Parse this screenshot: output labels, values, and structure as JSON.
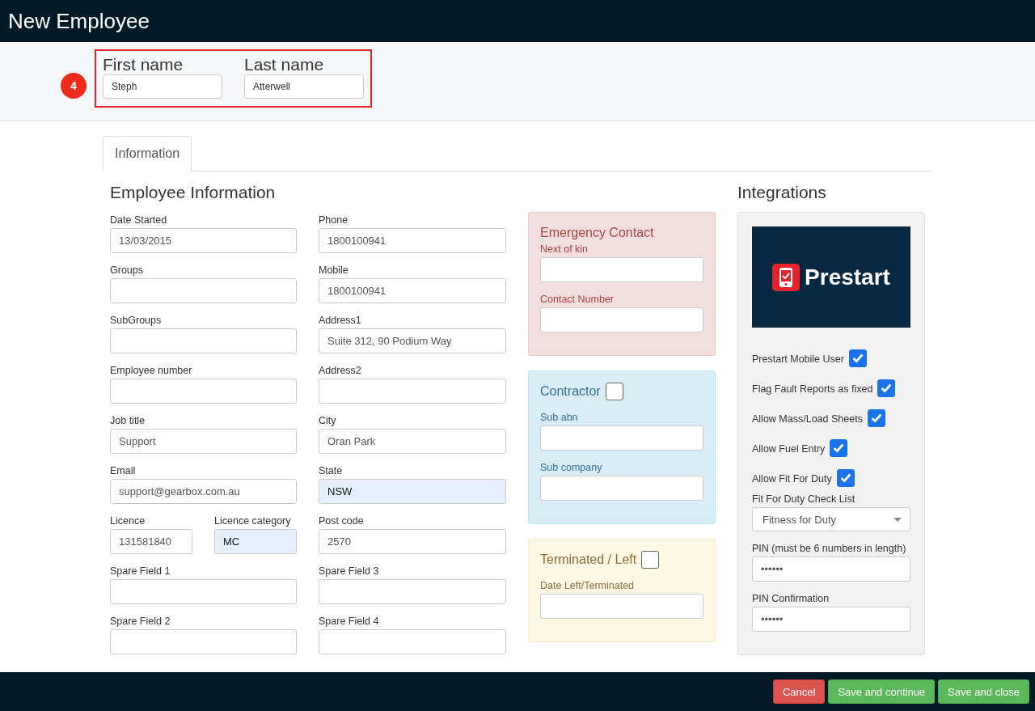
{
  "header": {
    "title": "New Employee"
  },
  "step_badge": "4",
  "name_fields": [
    {
      "label": "First name",
      "value": "Steph"
    },
    {
      "label": "Last name",
      "value": "Atterwell"
    }
  ],
  "tabs": [
    {
      "label": "Information",
      "selected": true
    }
  ],
  "employee_information": {
    "title": "Employee Information",
    "columns": [
      [
        {
          "fields": [
            {
              "label": "Date Started",
              "value": "13/03/2015",
              "autofilled": false
            }
          ]
        },
        {
          "fields": [
            {
              "label": "Groups",
              "autofilled": false
            }
          ]
        },
        {
          "fields": [
            {
              "label": "SubGroups",
              "autofilled": false
            }
          ]
        },
        {
          "fields": [
            {
              "label": "Employee number",
              "autofilled": false
            }
          ]
        },
        {
          "fields": [
            {
              "label": "Job title",
              "value": "Support",
              "autofilled": false
            }
          ]
        },
        {
          "fields": [
            {
              "label": "Email",
              "value": "support@gearbox.com.au",
              "autofilled": false
            }
          ]
        },
        {
          "fields": [
            {
              "label": "Licence",
              "value": "131581840",
              "autofilled": false
            },
            {
              "label": "Licence category",
              "value": "MC",
              "autofilled": true
            }
          ]
        },
        {
          "fields": [
            {
              "label": "Spare Field 1",
              "autofilled": false
            }
          ]
        },
        {
          "fields": [
            {
              "label": "Spare Field 2",
              "autofilled": false
            }
          ]
        }
      ],
      [
        {
          "fields": [
            {
              "label": "Phone",
              "value": "1800100941",
              "autofilled": false
            }
          ]
        },
        {
          "fields": [
            {
              "label": "Mobile",
              "value": "1800100941",
              "autofilled": false
            }
          ]
        },
        {
          "fields": [
            {
              "label": "Address1",
              "value": "Suite 312, 90 Podium Way",
              "autofilled": false
            }
          ]
        },
        {
          "fields": [
            {
              "label": "Address2",
              "autofilled": false
            }
          ]
        },
        {
          "fields": [
            {
              "label": "City",
              "value": "Oran Park",
              "autofilled": false
            }
          ]
        },
        {
          "fields": [
            {
              "label": "State",
              "value": "NSW",
              "autofilled": true
            }
          ]
        },
        {
          "fields": [
            {
              "label": "Post code",
              "value": "2570",
              "autofilled": false
            }
          ]
        },
        {
          "fields": [
            {
              "label": "Spare Field 3",
              "autofilled": false
            }
          ]
        },
        {
          "fields": [
            {
              "label": "Spare Field 4",
              "autofilled": false
            }
          ]
        }
      ]
    ]
  },
  "panels": [
    {
      "title": "Emergency Contact",
      "kind": "danger",
      "fields": [
        {
          "label": "Next of kin"
        },
        {
          "label": "Contact Number"
        }
      ]
    },
    {
      "title": "Contractor",
      "kind": "info",
      "checked": false,
      "fields": [
        {
          "label": "Sub abn"
        },
        {
          "label": "Sub company"
        }
      ]
    },
    {
      "title": "Terminated / Left",
      "kind": "warning",
      "checked": false,
      "fields": [
        {
          "label": "Date Left/Terminated"
        }
      ]
    }
  ],
  "integrations": {
    "title": "Integrations",
    "logo_text": "Prestart",
    "options": [
      {
        "label": "Prestart Mobile User",
        "checked": true
      },
      {
        "label": "Flag Fault Reports as fixed",
        "checked": true
      },
      {
        "label": "Allow Mass/Load Sheets",
        "checked": true
      },
      {
        "label": "Allow Fuel Entry",
        "checked": true
      },
      {
        "label": "Allow Fit For Duty",
        "checked": true
      }
    ],
    "select": {
      "label": "Fit For Duty Check List",
      "value": "Fitness for Duty"
    },
    "pins": [
      {
        "label": "PIN (must be 6 numbers in length)",
        "value": "••••••"
      },
      {
        "label": "PIN Confirmation",
        "value": "••••••"
      }
    ]
  },
  "footer_buttons": [
    {
      "label": "Cancel",
      "kind": "danger"
    },
    {
      "label": "Save and continue",
      "kind": "success"
    },
    {
      "label": "Save and close",
      "kind": "success"
    }
  ]
}
